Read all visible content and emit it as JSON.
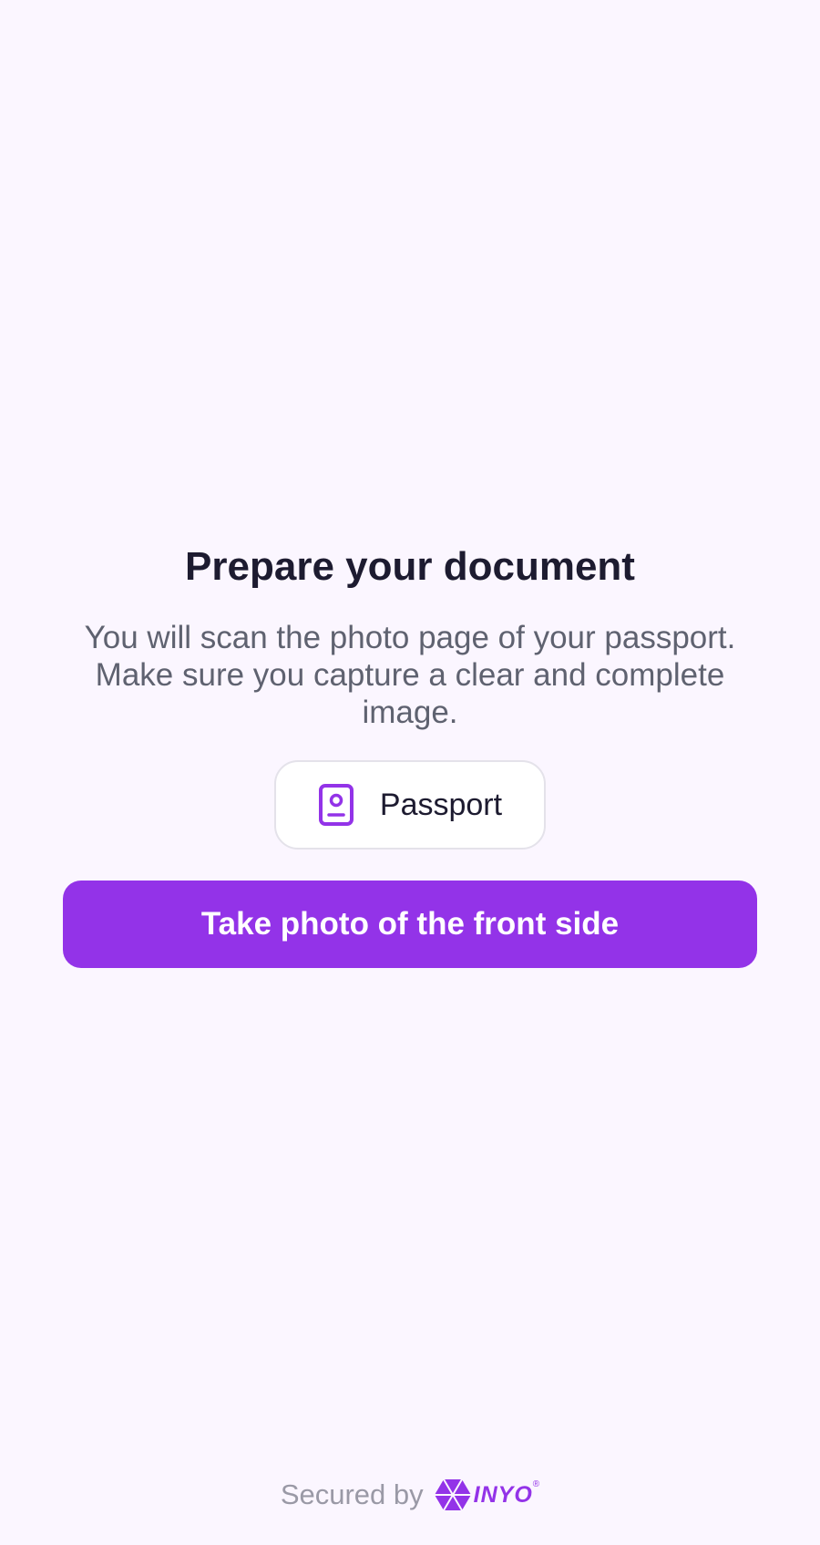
{
  "prepare": {
    "title": "Prepare your document",
    "description": "You will scan the photo page of your passport. Make sure you capture a clear and complete image."
  },
  "document_type": {
    "label": "Passport",
    "icon": "passport-icon"
  },
  "actions": {
    "take_photo_label": "Take photo of the front side"
  },
  "footer": {
    "secured_by": "Secured by",
    "brand": "INYO",
    "brand_mark": "®"
  },
  "colors": {
    "accent": "#9333e8",
    "background": "#fbf6ff",
    "title_text": "#1d1b30",
    "body_text": "#5f6270",
    "muted_text": "#9a99a6"
  }
}
